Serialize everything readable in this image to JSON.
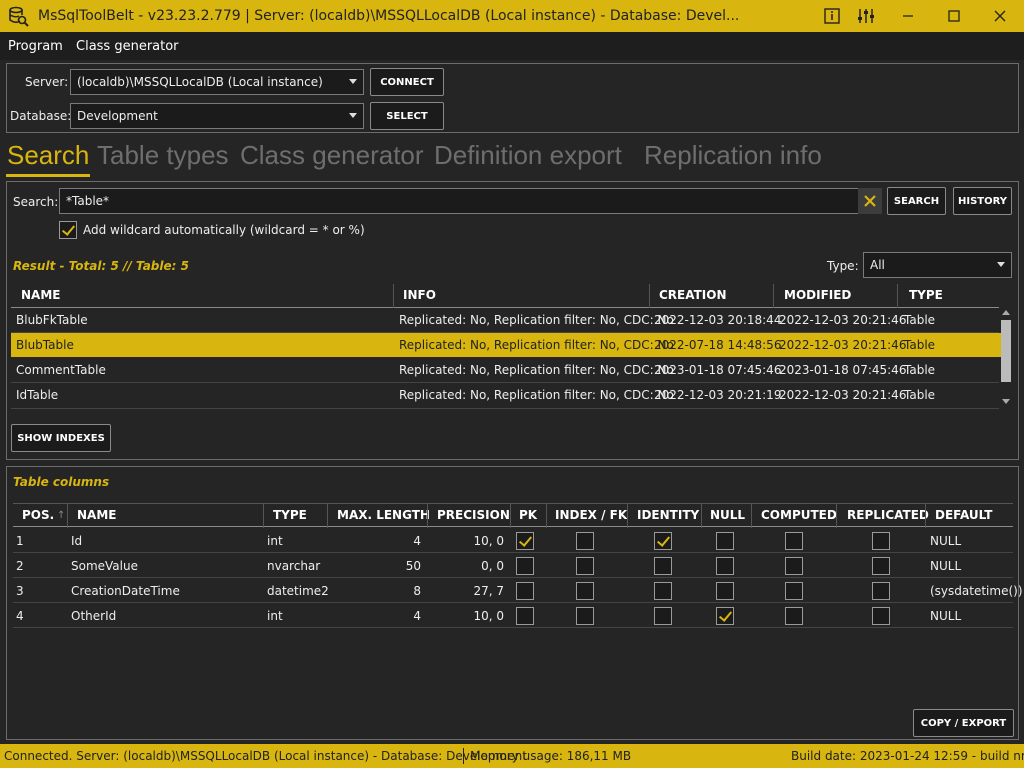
{
  "window": {
    "title": "MsSqlToolBelt - v23.23.2.779 | Server: (localdb)\\MSSQLLocalDB (Local instance) - Database: Devel...",
    "icon": "db-search-icon"
  },
  "menu": {
    "items": [
      "Program",
      "Class generator"
    ]
  },
  "connection": {
    "server_label": "Server:",
    "server_value": "(localdb)\\MSSQLLocalDB (Local instance)",
    "connect_label": "CONNECT",
    "database_label": "Database:",
    "database_value": "Development",
    "select_label": "SELECT"
  },
  "tabs": [
    "Search",
    "Table types",
    "Class generator",
    "Definition export",
    "Replication info"
  ],
  "search": {
    "label": "Search:",
    "value": "*Table*",
    "search_button": "SEARCH",
    "history_button": "HISTORY",
    "wildcard_label": "Add wildcard automatically (wildcard = * or %)",
    "wildcard_checked": true,
    "result_text": "Result - Total: 5 // Table: 5",
    "type_label": "Type:",
    "type_value": "All"
  },
  "results": {
    "headers": [
      "NAME",
      "INFO",
      "CREATION",
      "MODIFIED",
      "TYPE"
    ],
    "rows": [
      {
        "name": "BlubFkTable",
        "info": "Replicated: No, Replication filter: No, CDC: No",
        "creation": "2022-12-03 20:18:44",
        "modified": "2022-12-03 20:21:46",
        "type": "Table"
      },
      {
        "name": "BlubTable",
        "info": "Replicated: No, Replication filter: No, CDC: No",
        "creation": "2022-07-18 14:48:56",
        "modified": "2022-12-03 20:21:46",
        "type": "Table"
      },
      {
        "name": "CommentTable",
        "info": "Replicated: No, Replication filter: No, CDC: No",
        "creation": "2023-01-18 07:45:46",
        "modified": "2023-01-18 07:45:46",
        "type": "Table"
      },
      {
        "name": "IdTable",
        "info": "Replicated: No, Replication filter: No, CDC: No",
        "creation": "2022-12-03 20:21:19",
        "modified": "2022-12-03 20:21:46",
        "type": "Table"
      }
    ],
    "show_indexes_label": "SHOW INDEXES"
  },
  "columns": {
    "title": "Table columns",
    "headers": [
      "POS.",
      "NAME",
      "TYPE",
      "MAX. LENGTH",
      "PRECISION",
      "PK",
      "INDEX / FK",
      "IDENTITY",
      "NULL",
      "COMPUTED",
      "REPLICATED",
      "DEFAULT"
    ],
    "rows": [
      {
        "pos": "1",
        "name": "Id",
        "type": "int",
        "maxlen": "4",
        "precision": "10, 0",
        "pk": true,
        "index": false,
        "identity": true,
        "null": false,
        "computed": false,
        "replicated": false,
        "default": "NULL"
      },
      {
        "pos": "2",
        "name": "SomeValue",
        "type": "nvarchar",
        "maxlen": "50",
        "precision": "0, 0",
        "pk": false,
        "index": false,
        "identity": false,
        "null": false,
        "computed": false,
        "replicated": false,
        "default": "NULL"
      },
      {
        "pos": "3",
        "name": "CreationDateTime",
        "type": "datetime2",
        "maxlen": "8",
        "precision": "27, 7",
        "pk": false,
        "index": false,
        "identity": false,
        "null": false,
        "computed": false,
        "replicated": false,
        "default": "(sysdatetime())"
      },
      {
        "pos": "4",
        "name": "OtherId",
        "type": "int",
        "maxlen": "4",
        "precision": "10, 0",
        "pk": false,
        "index": false,
        "identity": false,
        "null": true,
        "computed": false,
        "replicated": false,
        "default": "NULL"
      }
    ],
    "copy_export_label": "COPY / EXPORT"
  },
  "status": {
    "connection": "Connected. Server: (localdb)\\MSSQLLocalDB (Local instance) - Database: Development",
    "memory": "Memory usage: 186,11 MB",
    "build": "Build date: 2023-01-24 12:59 - build nr. 3"
  },
  "colors": {
    "accent": "#d8b60f",
    "background": "#252526"
  }
}
